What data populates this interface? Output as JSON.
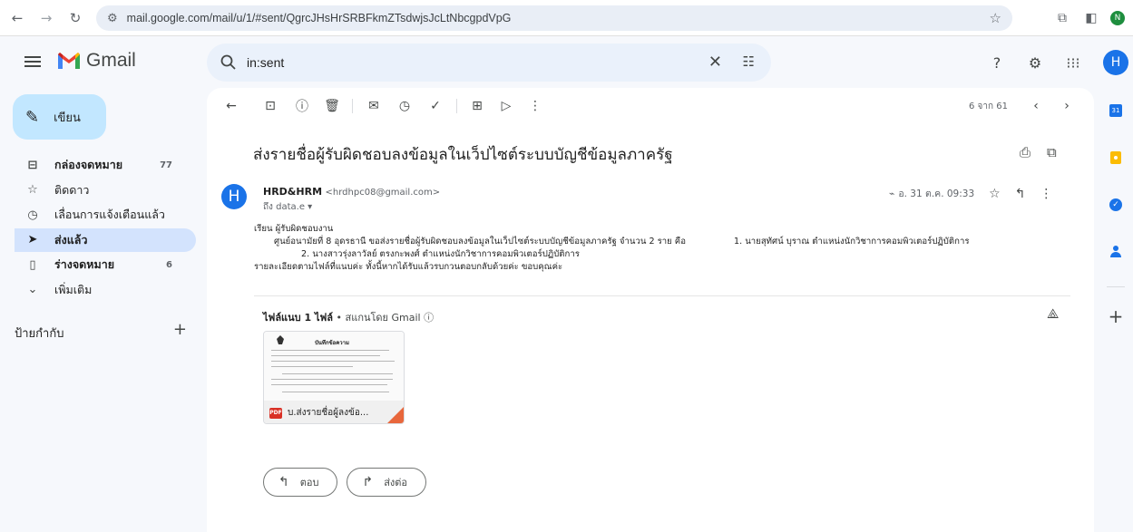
{
  "browser": {
    "url": "mail.google.com/mail/u/1/#sent/QgrcJHsHrSRBFkmZTsdwjsJcLtNbcgpdVpG",
    "profile_initial": "N"
  },
  "header": {
    "app_name": "Gmail",
    "search_value": "in:sent",
    "avatar_initial": "H"
  },
  "sidebar": {
    "compose_label": "เขียน",
    "items": [
      {
        "label": "กล่องจดหมาย",
        "count": "77",
        "icon": "inbox-icon"
      },
      {
        "label": "ติดดาว",
        "count": "",
        "icon": "star-icon"
      },
      {
        "label": "เลื่อนการแจ้งเตือนแล้ว",
        "count": "",
        "icon": "clock-icon"
      },
      {
        "label": "ส่งแล้ว",
        "count": "",
        "icon": "send-icon"
      },
      {
        "label": "ร่างจดหมาย",
        "count": "6",
        "icon": "draft-icon"
      },
      {
        "label": "เพิ่มเติม",
        "count": "",
        "icon": "chevron-down-icon"
      }
    ],
    "labels_title": "ป้ายกำกับ"
  },
  "toolbar": {
    "pager": "6 จาก 61"
  },
  "email": {
    "subject": "ส่งรายชื่อผู้รับผิดชอบลงข้อมูลในเว็ปไซต์ระบบบัญชีข้อมูลภาครัฐ",
    "sender_initial": "H",
    "sender_name": "HRD&HRM",
    "sender_email": "<hrdhpc08@gmail.com>",
    "to": "ถึง data.e",
    "date": "อ. 31 ต.ค. 09:33",
    "body": {
      "line1": "เรียน ผู้รับผิดชอบงาน",
      "line2a": "ศูนย์อนามัยที่ 8 อุดรธานี ขอส่งรายชื่อผู้รับผิดชอบลงข้อมูลในเว็ปไซต์ระบบบัญชีข้อมูลภาครัฐ จำนวน 2 ราย คือ",
      "line2b": "1. นายสุทัศน์ บุราณ ตำแหน่งนักวิชาการคอมพิวเตอร์ปฏิบัติการ",
      "line3": "2. นางสาวรุ่งลาวัลย์ ตรงกะพงศ์ ตำแหน่งนักวิชาการคอมพิวเตอร์ปฏิบัติการ",
      "line4": "รายละเอียดตามไฟล์ที่แนบค่ะ ทั้งนี้หากได้รับแล้วรบกวนตอบกลับด้วยค่ะ ขอบคุณค่ะ"
    },
    "attachments_title": "ไฟล์แนบ 1 ไฟล์",
    "attachments_scan": " • สแกนโดย Gmail ⓘ",
    "attachment_name": "บ.ส่งรายชื่อผู้ลงข้อ...",
    "attachment_thumb_title": "บันทึกข้อความ",
    "reply_label": "ตอบ",
    "forward_label": "ส่งต่อ"
  },
  "right_rail": {
    "calendar_day": "31"
  }
}
